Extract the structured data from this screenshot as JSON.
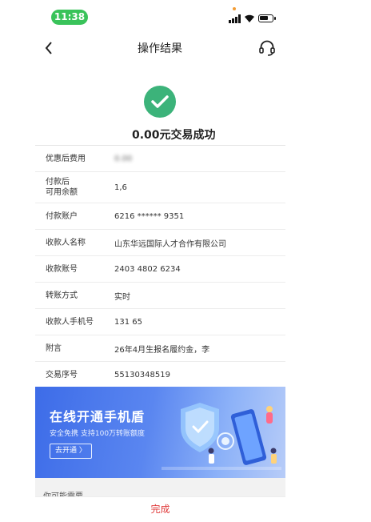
{
  "status_bar": {
    "time": "11:38"
  },
  "nav": {
    "title": "操作结果"
  },
  "result": {
    "message": "0.00元交易成功"
  },
  "details": [
    {
      "label": "优惠后费用",
      "value": "0.00",
      "blurred": true
    },
    {
      "label": "付款后\n可用余额",
      "value": "1,6",
      "blurred": true
    },
    {
      "label": "付款账户",
      "value": "6216 ****** 9351"
    },
    {
      "label": "收款人名称",
      "value": "山东华远国际人才合作有限公司"
    },
    {
      "label": "收款账号",
      "value": "2403 4802 6234"
    },
    {
      "label": "转账方式",
      "value": "实时"
    },
    {
      "label": "收款人手机号",
      "value": "131 65",
      "blurred": true
    },
    {
      "label": "附言",
      "value": "26年4月生报名履约金，李"
    },
    {
      "label": "交易序号",
      "value": "55130348519"
    }
  ],
  "banner": {
    "title": "在线开通手机盾",
    "subtitle": "安全免携 支持100万转账额度",
    "button": "去开通 〉"
  },
  "maybe_need": "你可能需要",
  "done_button": "完成",
  "colors": {
    "success": "#3cb37a",
    "accent_red": "#e03a3a",
    "status_green": "#39c35a",
    "banner_blue": "#3d6ce8"
  }
}
